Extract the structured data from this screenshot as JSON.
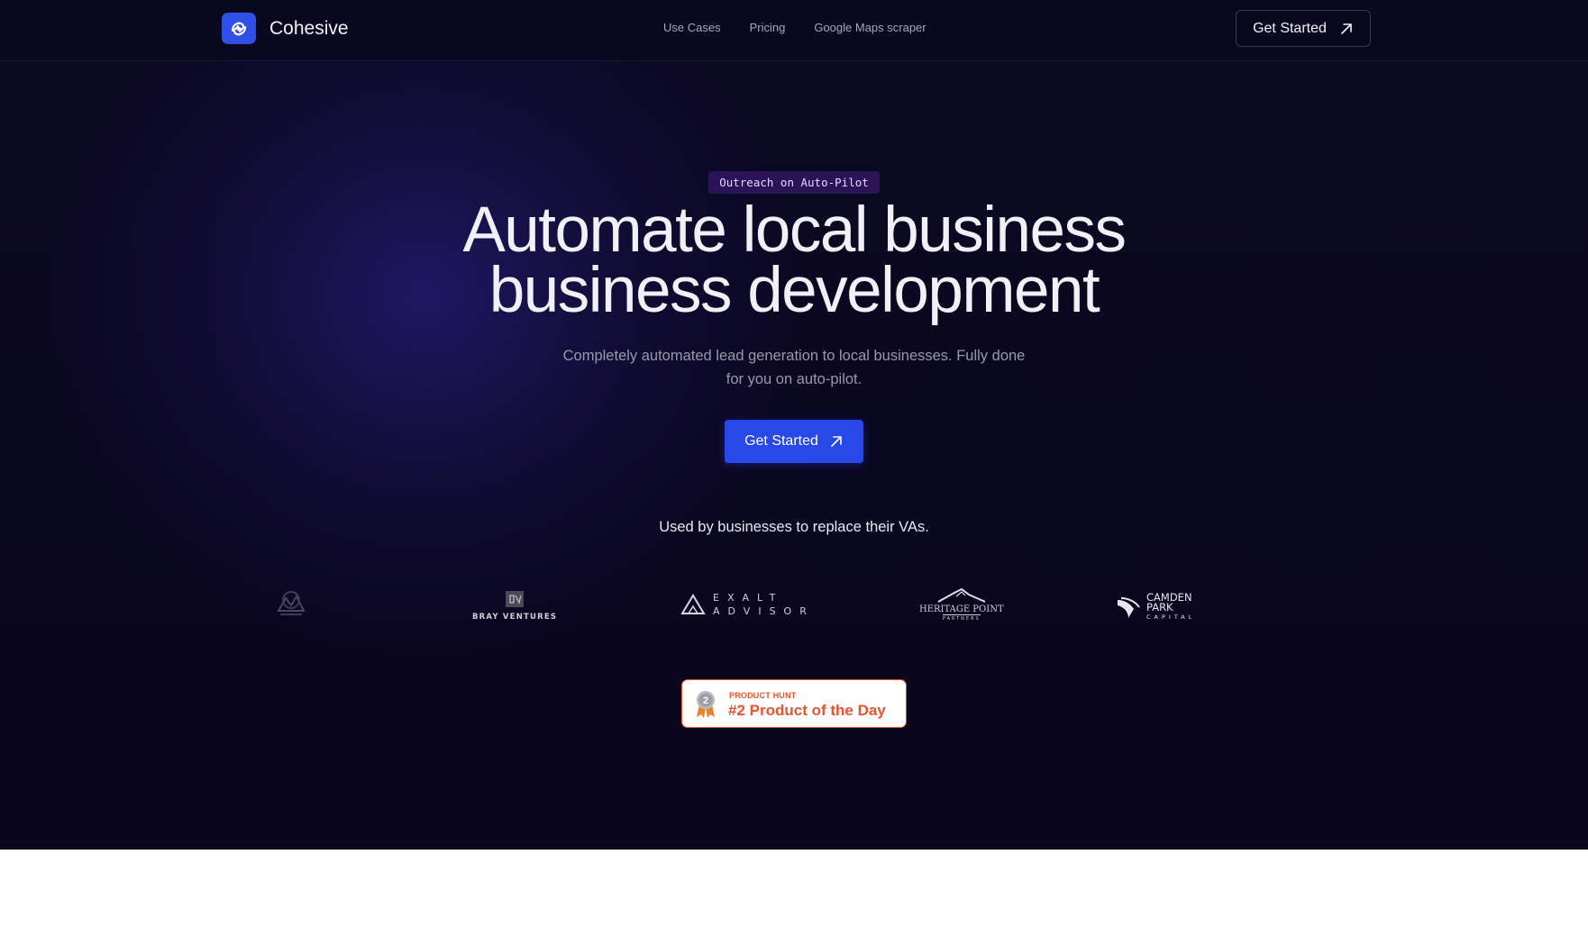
{
  "nav": {
    "brand": "Cohesive",
    "links": [
      "Use Cases",
      "Pricing",
      "Google Maps scraper"
    ],
    "cta": "Get Started"
  },
  "hero": {
    "badge": "Outreach on Auto-Pilot",
    "headline_line1": "Automate local business",
    "headline_line2": "business development",
    "subhead": "Completely automated lead generation to local businesses. Fully done for you on auto-pilot.",
    "cta": "Get Started",
    "social_proof": "Used by businesses to replace their VAs."
  },
  "logos": [
    {
      "name": "Bray Ventures",
      "text": "BRAY VENTURES"
    },
    {
      "name": "Exalt Advisor",
      "line1": "EXALT",
      "line2": "ADVISOR"
    },
    {
      "name": "Heritage Point Partners",
      "line1": "HERITAGE POINT",
      "line2": "PARTNERS"
    },
    {
      "name": "Camden Park Capital",
      "line1": "CAMDEN",
      "line2": "PARK",
      "line3": "CAPITAL"
    }
  ],
  "product_hunt": {
    "kicker": "PRODUCT HUNT",
    "title": "#2 Product of the Day",
    "rank": "2"
  },
  "colors": {
    "brand": "#2f4fe6",
    "background": "#0a0720",
    "product_hunt": "#e8542e"
  }
}
